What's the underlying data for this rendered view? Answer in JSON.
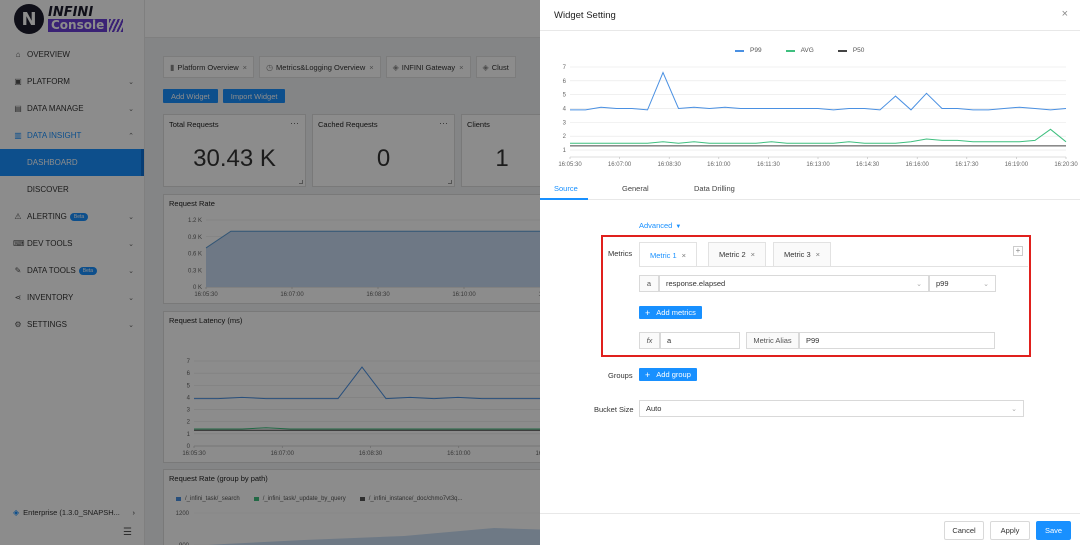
{
  "brand": {
    "mark": "N",
    "name_top": "INFINI",
    "name_bottom": "Console"
  },
  "sidebar": {
    "items": [
      {
        "icon": "⌂",
        "label": "OVERVIEW",
        "chevron": ""
      },
      {
        "icon": "▣",
        "label": "PLATFORM",
        "chevron": "⌄"
      },
      {
        "icon": "▤",
        "label": "DATA MANAGE",
        "chevron": "⌄"
      },
      {
        "icon": "▥",
        "label": "DATA INSIGHT",
        "chevron": "⌃"
      },
      {
        "icon": "",
        "label": "DASHBOARD",
        "chevron": ""
      },
      {
        "icon": "",
        "label": "DISCOVER",
        "chevron": ""
      },
      {
        "icon": "⚠",
        "label": "ALERTING",
        "chevron": "⌄",
        "badge": "Beta"
      },
      {
        "icon": "⌨",
        "label": "DEV TOOLS",
        "chevron": "⌄"
      },
      {
        "icon": "✎",
        "label": "DATA TOOLS",
        "chevron": "⌄",
        "badge": "Beta"
      },
      {
        "icon": "⋖",
        "label": "INVENTORY",
        "chevron": "⌄"
      },
      {
        "icon": "⚙",
        "label": "SETTINGS",
        "chevron": "⌄"
      }
    ],
    "enterprise": {
      "label": "Enterprise (1.3.0_SNAPSH...",
      "chevron": "›"
    },
    "collapse_glyph": "☰"
  },
  "dashboard": {
    "tabs": [
      {
        "icon": "▮",
        "label": "Platform Overview",
        "close": "×"
      },
      {
        "icon": "◷",
        "label": "Metrics&Logging Overview",
        "close": "×"
      },
      {
        "icon": "◈",
        "label": "INFINI Gateway",
        "close": "×"
      },
      {
        "icon": "◈",
        "label": "Clust",
        "close": ""
      }
    ],
    "buttons": {
      "add_widget": "Add Widget",
      "import_widget": "Import Widget"
    },
    "stats": [
      {
        "title": "Total Requests",
        "value": "30.43 K",
        "menu": "···"
      },
      {
        "title": "Cached Requests",
        "value": "0",
        "menu": "···"
      },
      {
        "title": "Clients",
        "value": "1",
        "menu": ""
      }
    ],
    "panels": {
      "rate_title": "Request Rate",
      "latency_title": "Request Latency (ms)",
      "path_title": "Request Rate (group by path)",
      "path_legend": [
        {
          "label": "/_infini_task/_search",
          "color": "#4a90e2"
        },
        {
          "label": "/_infini_task/_update_by_query",
          "color": "#3fbf7f"
        },
        {
          "label": "/_infini_instance/_doc/chmo7vt3q...",
          "color": "#555555"
        }
      ],
      "path_y_top": "1200",
      "path_y_second": "900"
    }
  },
  "chart_data": [
    {
      "type": "area",
      "title": "Request Rate",
      "x": [
        "16:05:30",
        "16:07:00",
        "16:08:30",
        "16:10:00",
        "16:11:30"
      ],
      "yticks": [
        "0 K",
        "0.3 K",
        "0.6 K",
        "0.9 K",
        "1.2 K"
      ],
      "ylim": [
        0,
        1.2
      ],
      "series": [
        {
          "values": [
            0.7,
            1.0,
            1.0,
            1.0,
            1.0,
            1.0,
            1.0,
            1.0,
            1.0,
            1.0,
            1.0,
            1.0,
            1.0,
            1.0,
            1.0
          ]
        }
      ]
    },
    {
      "type": "line",
      "title": "Request Latency (ms)",
      "x": [
        "16:05:30",
        "16:07:00",
        "16:08:30",
        "16:10:00",
        "16:11:30"
      ],
      "yticks": [
        "0",
        "1",
        "2",
        "3",
        "4",
        "5",
        "6",
        "7"
      ],
      "ylim": [
        0,
        7
      ],
      "series": [
        {
          "color": "#4a90e2",
          "values": [
            3.9,
            3.9,
            4.0,
            3.9,
            3.9,
            3.9,
            3.9,
            6.5,
            3.9,
            4.0,
            3.9,
            4.0,
            3.9,
            3.9,
            3.9,
            3.9
          ]
        },
        {
          "color": "#3fbf7f",
          "values": [
            1.4,
            1.4,
            1.4,
            1.5,
            1.4,
            1.4,
            1.4,
            1.4,
            1.4,
            1.4,
            1.4,
            1.4,
            1.4,
            1.4,
            1.4,
            1.4
          ]
        },
        {
          "color": "#444444",
          "values": [
            1.3,
            1.3,
            1.3,
            1.3,
            1.3,
            1.3,
            1.3,
            1.3,
            1.3,
            1.3,
            1.3,
            1.3,
            1.3,
            1.3,
            1.3,
            1.3
          ]
        }
      ]
    },
    {
      "type": "line",
      "title": "",
      "x": [
        "16:05:30",
        "16:07:00",
        "16:08:30",
        "16:10:00",
        "16:11:30",
        "16:13:00",
        "16:14:30",
        "16:16:00",
        "16:17:30",
        "16:19:00",
        "16:20:30"
      ],
      "yticks": [
        "1",
        "2",
        "3",
        "4",
        "5",
        "6",
        "7"
      ],
      "ylim": [
        0.5,
        7
      ],
      "series": [
        {
          "name": "P99",
          "color": "#4a90e2",
          "values": [
            3.9,
            3.9,
            4.1,
            4.0,
            4.0,
            3.9,
            6.6,
            4.0,
            4.1,
            4.0,
            4.1,
            4.0,
            4.0,
            4.0,
            4.0,
            4.0,
            4.0,
            3.9,
            4.0,
            4.0,
            3.9,
            4.9,
            3.9,
            5.1,
            4.0,
            4.0,
            3.9,
            3.9,
            4.0,
            4.1,
            4.0,
            3.9,
            4.0
          ]
        },
        {
          "name": "AVG",
          "color": "#3fbf7f",
          "values": [
            1.5,
            1.5,
            1.5,
            1.5,
            1.5,
            1.5,
            1.6,
            1.5,
            1.6,
            1.5,
            1.5,
            1.5,
            1.5,
            1.6,
            1.5,
            1.5,
            1.5,
            1.5,
            1.6,
            1.5,
            1.5,
            1.5,
            1.6,
            1.8,
            1.7,
            1.7,
            1.6,
            1.6,
            1.6,
            1.6,
            1.7,
            2.5,
            1.6
          ]
        },
        {
          "name": "P50",
          "color": "#444444",
          "values": [
            1.3,
            1.3,
            1.3,
            1.3,
            1.3,
            1.3,
            1.3,
            1.3,
            1.3,
            1.3,
            1.3,
            1.3,
            1.3,
            1.3,
            1.3,
            1.3,
            1.3,
            1.3,
            1.3,
            1.3,
            1.3,
            1.3,
            1.3,
            1.3,
            1.3,
            1.3,
            1.3,
            1.3,
            1.3,
            1.3,
            1.3,
            1.3,
            1.3
          ]
        }
      ]
    }
  ],
  "drawer": {
    "title": "Widget Setting",
    "close": "×",
    "subtabs": [
      "Source",
      "General",
      "Data Drilling"
    ],
    "advanced": "Advanced",
    "advanced_caret": "▼",
    "metrics_label": "Metrics",
    "metric_tabs": [
      {
        "label": "Metric 1",
        "close": "×"
      },
      {
        "label": "Metric 2",
        "close": "×"
      },
      {
        "label": "Metric 3",
        "close": "×"
      }
    ],
    "add_tab": "+",
    "metric_var": "a",
    "metric_field": "response.elapsed",
    "metric_agg": "p99",
    "add_metrics": "Add metrics",
    "fx_label": "fx",
    "fx_value": "a",
    "alias_label": "Metric Alias",
    "alias_value": "P99",
    "groups_label": "Groups",
    "add_group": "Add group",
    "bucket_label": "Bucket Size",
    "bucket_value": "Auto",
    "footer": {
      "cancel": "Cancel",
      "apply": "Apply",
      "save": "Save"
    }
  }
}
